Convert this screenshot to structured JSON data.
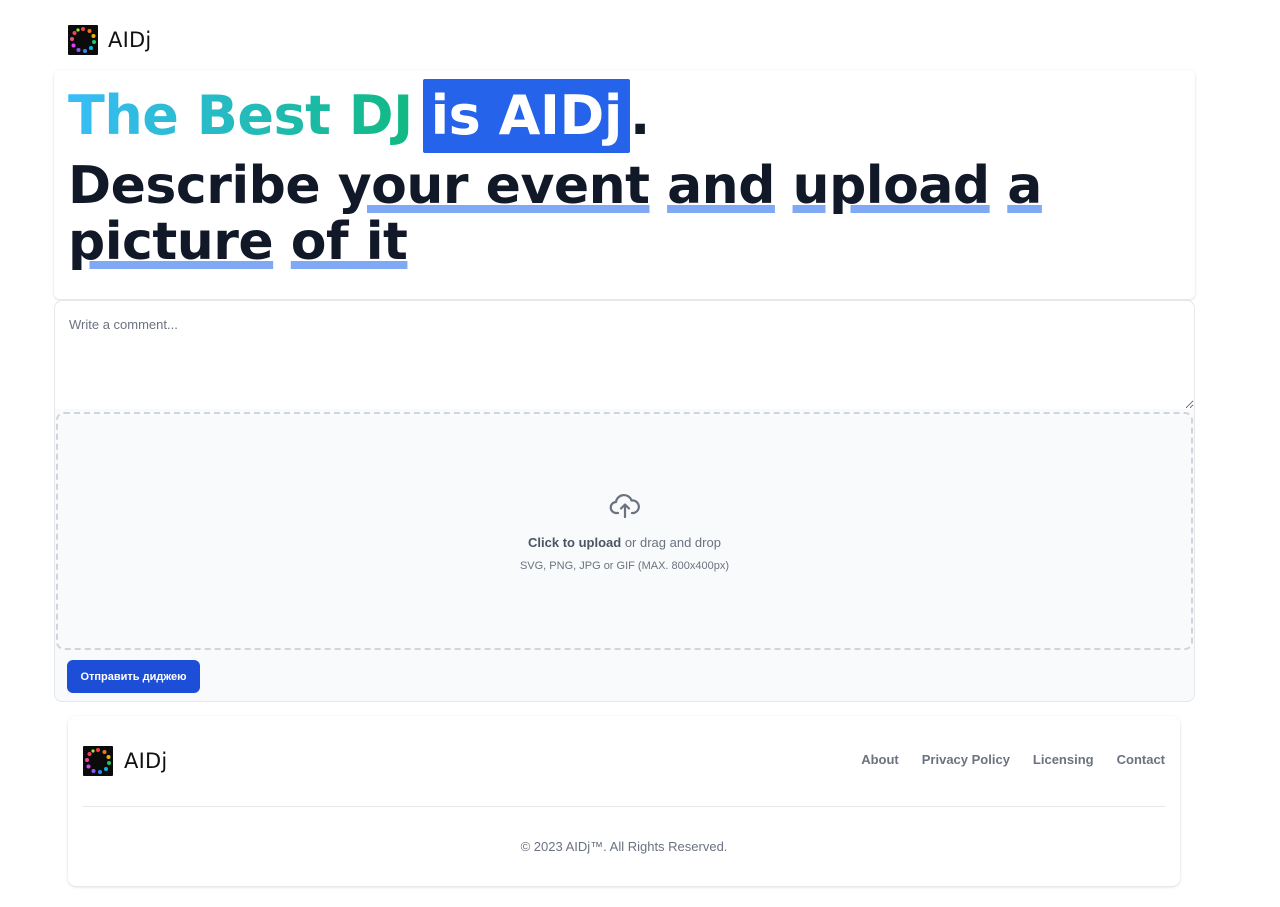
{
  "brand": {
    "name": "AIDj",
    "logo_icon": "vinyl-dots-logo-icon"
  },
  "hero": {
    "title_gradient": "The Best DJ",
    "title_highlight": "is AIDj",
    "title_period": ".",
    "subtitle_lead": "Describe ",
    "subtitle_words": [
      "your event",
      "and",
      "upload",
      "a",
      "picture",
      "of it"
    ]
  },
  "form": {
    "comment_placeholder": "Write a comment...",
    "upload_icon": "cloud-upload-icon",
    "upload_bold": "Click to upload",
    "upload_rest": " or drag and drop",
    "upload_hint": "SVG, PNG, JPG or GIF (MAX. 800x400px)",
    "submit_label": "Отправить диджею"
  },
  "footer": {
    "links": [
      "About",
      "Privacy Policy",
      "Licensing",
      "Contact"
    ],
    "copyright": "© 2023 AIDj™. All Rights Reserved."
  },
  "colors": {
    "accent": "#2563eb",
    "button": "#1d4ed8",
    "gradient_start": "#38bdf8",
    "gradient_end": "#10b981",
    "underline": "#7fa8f5"
  }
}
